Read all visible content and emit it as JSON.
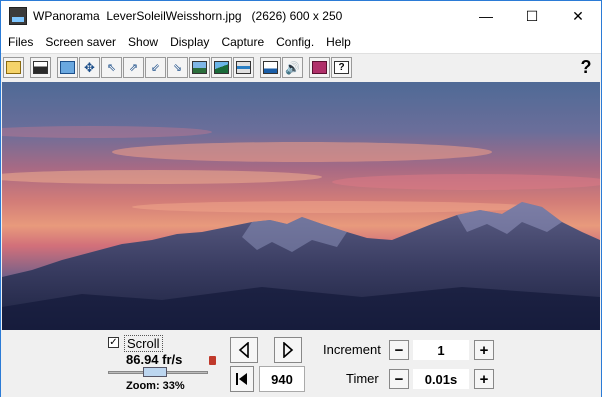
{
  "window": {
    "app_name": "WPanorama",
    "file_info": "LeverSoleilWeisshorn.jpg   (2626) 600 x 250",
    "minimize_glyph": "—",
    "maximize_glyph": "☐",
    "close_glyph": "✕"
  },
  "menu": [
    "Files",
    "Screen saver",
    "Show",
    "Display",
    "Capture",
    "Config.",
    "Help"
  ],
  "toolbar": {
    "help_label": "?"
  },
  "controls": {
    "scroll_label": "Scroll",
    "scroll_checked": true,
    "speed": "86.94 fr/s",
    "zoom": "Zoom: 33%",
    "zoom_level_percent": 33,
    "position": "940",
    "increment_label": "Increment",
    "increment_value": "1",
    "timer_label": "Timer",
    "timer_value": "0.01s",
    "minus_glyph": "−",
    "plus_glyph": "+",
    "check_glyph": "✓"
  }
}
